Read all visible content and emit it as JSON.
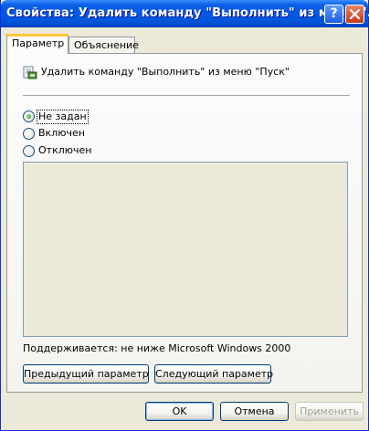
{
  "window": {
    "title": "Свойства: Удалить команду \"Выполнить\" из меню \"...",
    "help_label": "?"
  },
  "tabs": [
    {
      "label": "Параметр",
      "selected": true
    },
    {
      "label": "Объяснение",
      "selected": false
    }
  ],
  "policy": {
    "icon": "policy-setting-icon",
    "name": "Удалить команду \"Выполнить\" из меню \"Пуск\""
  },
  "options": [
    {
      "label": "Не задан",
      "selected": true
    },
    {
      "label": "Включен",
      "selected": false
    },
    {
      "label": "Отключен",
      "selected": false
    }
  ],
  "supported_text": "Поддерживается:  не ниже Microsoft Windows 2000",
  "nav_buttons": {
    "previous": "Предыдущий параметр",
    "next": "Следующий параметр"
  },
  "dialog_buttons": {
    "ok": "OK",
    "cancel": "Отмена",
    "apply": "Применить"
  },
  "colors": {
    "titlebar": "#0058e6",
    "dialog_bg": "#ece9d8",
    "tab_highlight": "#ffc83c",
    "radio_selected": "#21a121"
  }
}
